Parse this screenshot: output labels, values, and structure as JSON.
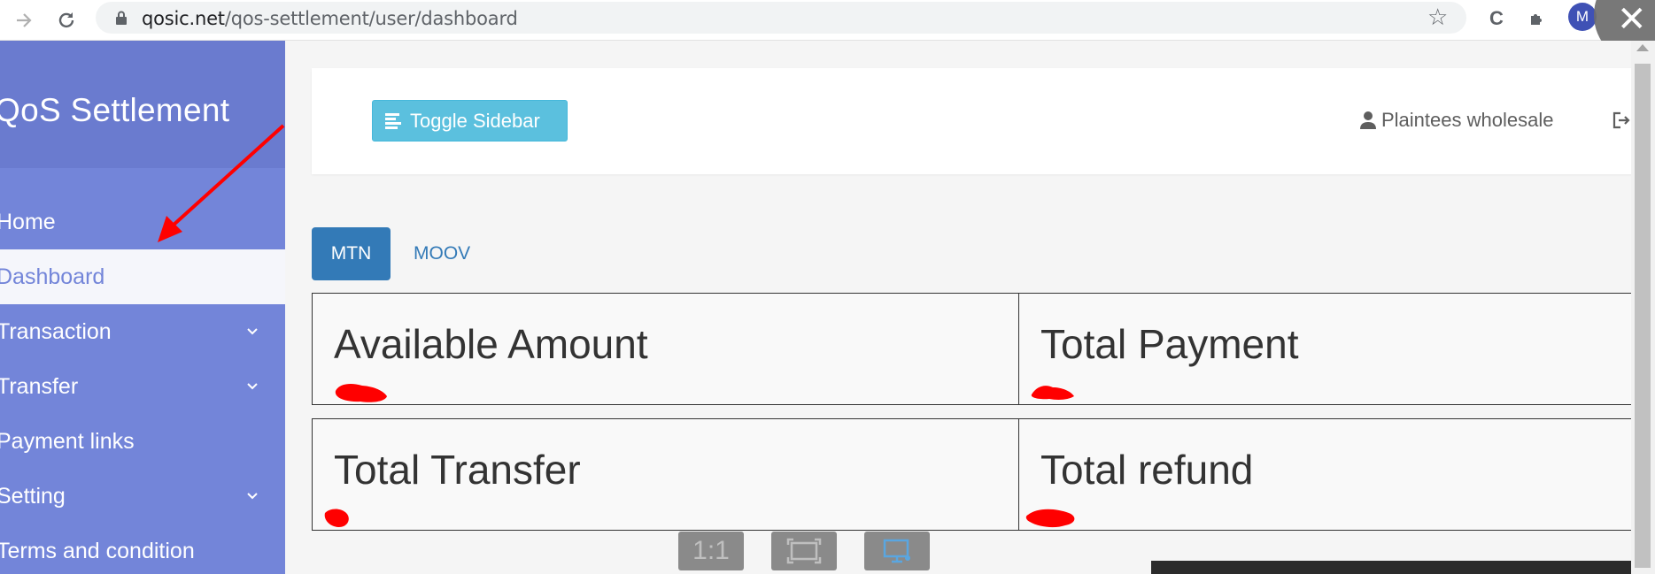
{
  "browser": {
    "url_host": "qosic.net",
    "url_path": "/qos-settlement/user/dashboard",
    "profile_initial": "M"
  },
  "sidebar": {
    "brand": "QoS Settlement",
    "items": [
      {
        "label": "Home",
        "has_children": false,
        "active": false
      },
      {
        "label": "Dashboard",
        "has_children": false,
        "active": true
      },
      {
        "label": "Transaction",
        "has_children": true,
        "active": false
      },
      {
        "label": "Transfer",
        "has_children": true,
        "active": false
      },
      {
        "label": "Payment links",
        "has_children": false,
        "active": false
      },
      {
        "label": "Setting",
        "has_children": true,
        "active": false
      },
      {
        "label": "Terms and condition",
        "has_children": false,
        "active": false
      }
    ]
  },
  "topbar": {
    "toggle_label": "Toggle Sidebar",
    "user_label": "Plaintees wholesale",
    "logout_label": "Lo"
  },
  "tabs": [
    {
      "label": "MTN",
      "active": true
    },
    {
      "label": "MOOV",
      "active": false
    }
  ],
  "cards": [
    {
      "title": "Available Amount"
    },
    {
      "title": "Total Payment"
    },
    {
      "title": "Total Transfer"
    },
    {
      "title": "Total refund"
    }
  ],
  "viewer": {
    "actual_size_label": "1:1"
  },
  "colors": {
    "sidebar": "#7385d9",
    "sidebar_header": "#6a7bcf",
    "toggle_button": "#5bc0de",
    "tab_active": "#337ab7",
    "annotation": "#ff0000"
  }
}
